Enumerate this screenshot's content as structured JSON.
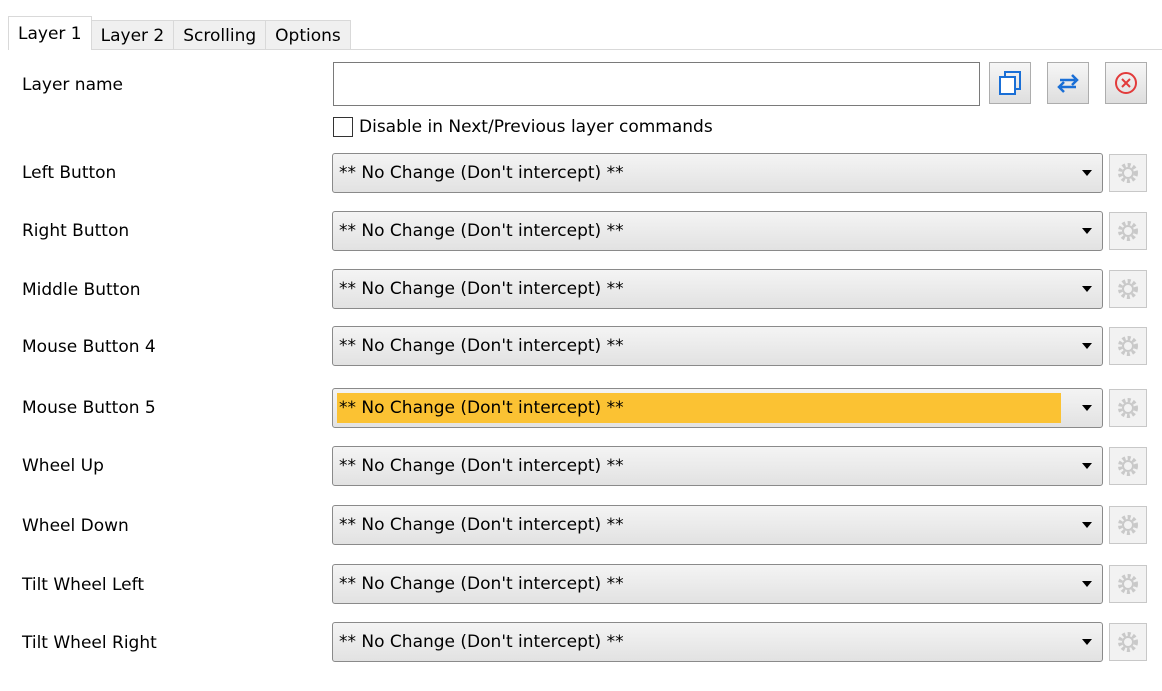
{
  "tabs": [
    {
      "label": "Layer 1",
      "active": true
    },
    {
      "label": "Layer 2",
      "active": false
    },
    {
      "label": "Scrolling",
      "active": false
    },
    {
      "label": "Options",
      "active": false
    }
  ],
  "layer_name": {
    "label": "Layer name",
    "value": ""
  },
  "toolbar": {
    "copy_icon": "copy-icon",
    "swap_icon": "swap-arrows-icon",
    "delete_icon": "delete-circle-x-icon"
  },
  "disable_checkbox": {
    "label": "Disable in Next/Previous layer commands",
    "checked": false
  },
  "rows": [
    {
      "label": "Left Button",
      "value": "** No Change (Don't intercept) **",
      "highlighted": false
    },
    {
      "label": "Right Button",
      "value": "** No Change (Don't intercept) **",
      "highlighted": false
    },
    {
      "label": "Middle Button",
      "value": "** No Change (Don't intercept) **",
      "highlighted": false
    },
    {
      "label": "Mouse Button 4",
      "value": "** No Change (Don't intercept) **",
      "highlighted": false
    },
    {
      "label": "Mouse Button 5",
      "value": "** No Change (Don't intercept) **",
      "highlighted": true
    },
    {
      "label": "Wheel Up",
      "value": "** No Change (Don't intercept) **",
      "highlighted": false
    },
    {
      "label": "Wheel Down",
      "value": "** No Change (Don't intercept) **",
      "highlighted": false
    },
    {
      "label": "Tilt Wheel Left",
      "value": "** No Change (Don't intercept) **",
      "highlighted": false
    },
    {
      "label": "Tilt Wheel Right",
      "value": "** No Change (Don't intercept) **",
      "highlighted": false
    }
  ],
  "colors": {
    "highlight": "#fbc233",
    "accent_blue": "#1a6fd6",
    "delete_red": "#e23b3b"
  }
}
